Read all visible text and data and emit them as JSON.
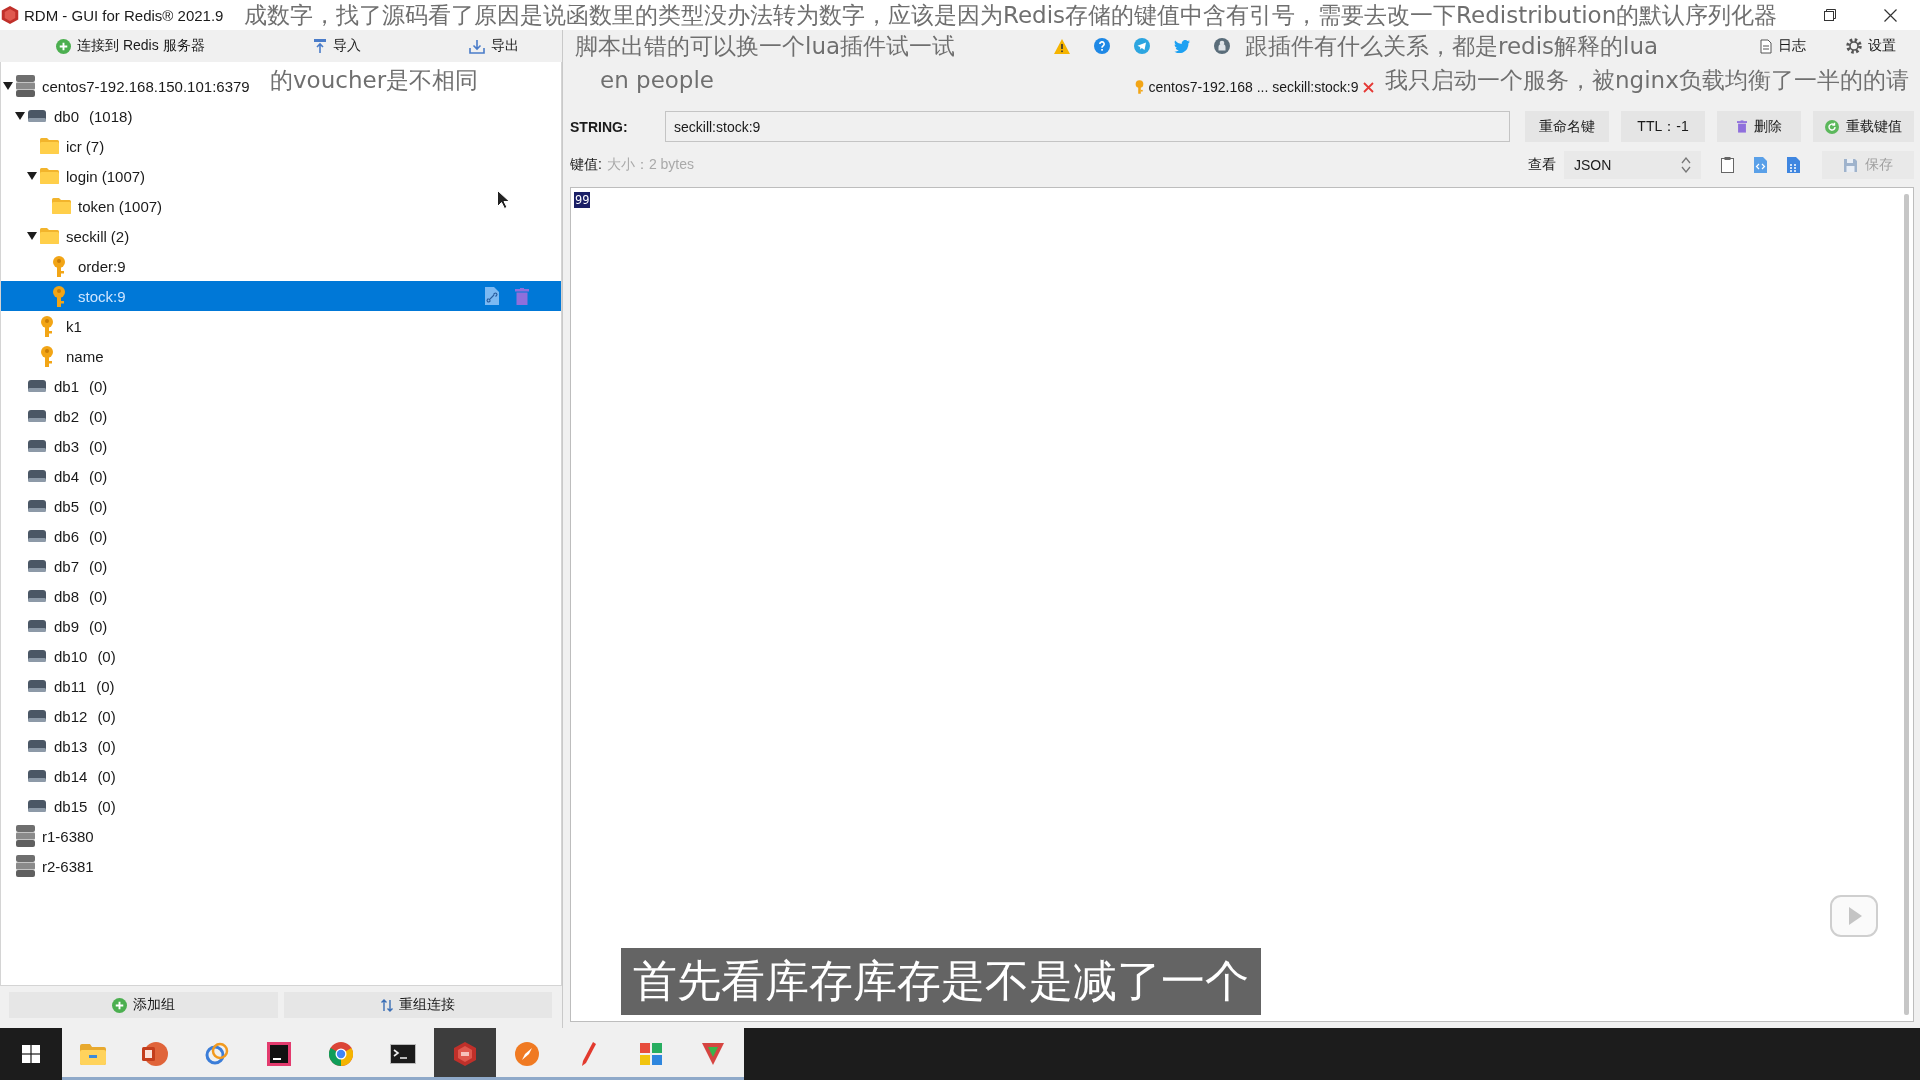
{
  "window": {
    "title": "RDM - GUI for Redis® 2021.9"
  },
  "toolbar": {
    "left": [
      {
        "kind": "connect",
        "label": "连接到 Redis 服务器"
      },
      {
        "kind": "import",
        "label": "导入"
      },
      {
        "kind": "export",
        "label": "导出"
      }
    ],
    "right": [
      {
        "kind": "log",
        "label": "日志"
      },
      {
        "kind": "settings",
        "label": "设置"
      }
    ]
  },
  "tree": [
    {
      "kind": "server",
      "label": "centos7-192.168.150.101:6379",
      "expanded": true,
      "selected": false,
      "children": [
        {
          "kind": "db",
          "label": "db0",
          "count": "(1018)",
          "expanded": true,
          "selected": false,
          "children": [
            {
              "kind": "folder",
              "label": "icr",
              "count": "(7)",
              "selected": false
            },
            {
              "kind": "folder",
              "label": "login",
              "count": "(1007)",
              "expanded": true,
              "selected": false,
              "children": [
                {
                  "kind": "folder",
                  "label": "token",
                  "count": "(1007)",
                  "selected": false
                }
              ]
            },
            {
              "kind": "folder",
              "label": "seckill",
              "count": "(2)",
              "expanded": true,
              "selected": false,
              "children": [
                {
                  "kind": "key",
                  "label": "order:9",
                  "selected": false
                },
                {
                  "kind": "key",
                  "label": "stock:9",
                  "selected": true
                }
              ]
            },
            {
              "kind": "key",
              "label": "k1",
              "selected": false
            },
            {
              "kind": "key",
              "label": "name",
              "selected": false
            }
          ]
        },
        {
          "kind": "db",
          "label": "db1",
          "count": "(0)",
          "selected": false
        },
        {
          "kind": "db",
          "label": "db2",
          "count": "(0)",
          "selected": false
        },
        {
          "kind": "db",
          "label": "db3",
          "count": "(0)",
          "selected": false
        },
        {
          "kind": "db",
          "label": "db4",
          "count": "(0)",
          "selected": false
        },
        {
          "kind": "db",
          "label": "db5",
          "count": "(0)",
          "selected": false
        },
        {
          "kind": "db",
          "label": "db6",
          "count": "(0)",
          "selected": false
        },
        {
          "kind": "db",
          "label": "db7",
          "count": "(0)",
          "selected": false
        },
        {
          "kind": "db",
          "label": "db8",
          "count": "(0)",
          "selected": false
        },
        {
          "kind": "db",
          "label": "db9",
          "count": "(0)",
          "selected": false
        },
        {
          "kind": "db",
          "label": "db10",
          "count": "(0)",
          "selected": false
        },
        {
          "kind": "db",
          "label": "db11",
          "count": "(0)",
          "selected": false
        },
        {
          "kind": "db",
          "label": "db12",
          "count": "(0)",
          "selected": false
        },
        {
          "kind": "db",
          "label": "db13",
          "count": "(0)",
          "selected": false
        },
        {
          "kind": "db",
          "label": "db14",
          "count": "(0)",
          "selected": false
        },
        {
          "kind": "db",
          "label": "db15",
          "count": "(0)",
          "selected": false
        }
      ]
    },
    {
      "kind": "server",
      "label": "r1-6380",
      "selected": false
    },
    {
      "kind": "server",
      "label": "r2-6381",
      "selected": false
    }
  ],
  "sidebar_buttons": [
    {
      "kind": "add",
      "label": "添加组"
    },
    {
      "kind": "regroup",
      "label": "重组连接"
    }
  ],
  "tabs": [
    {
      "label": "centos7-192.168 ... seckill:stock:9"
    }
  ],
  "key_view": {
    "type": "STRING:",
    "name": "seckill:stock:9",
    "actions": [
      {
        "kind": "rename",
        "label": "重命名键"
      },
      {
        "kind": "ttl",
        "label": "TTL：-1"
      },
      {
        "kind": "delete",
        "label": "删除"
      },
      {
        "kind": "reload",
        "label": "重载键值"
      }
    ],
    "value_label": "键值:",
    "size": "大小：2 bytes",
    "view_label": "查看",
    "view_mode": "JSON",
    "save": {
      "label": "保存",
      "disabled": true
    },
    "value": {
      "text": "99",
      "selected": true
    }
  },
  "taskbar": {
    "apps": [
      {
        "kind": "explorer",
        "running": true,
        "selected": false
      },
      {
        "kind": "presentation",
        "running": true,
        "selected": false
      },
      {
        "kind": "rings",
        "running": true,
        "selected": false
      },
      {
        "kind": "ide",
        "running": true,
        "selected": false
      },
      {
        "kind": "browser",
        "running": true,
        "selected": false
      },
      {
        "kind": "terminal",
        "running": true,
        "selected": false
      },
      {
        "kind": "redis-manager",
        "running": true,
        "selected": true
      },
      {
        "kind": "compass",
        "running": true,
        "selected": false
      },
      {
        "kind": "pen",
        "running": true,
        "selected": false
      },
      {
        "kind": "grid-app",
        "running": true,
        "selected": false
      },
      {
        "kind": "arrow-app",
        "running": true,
        "selected": false
      }
    ]
  },
  "overlay": {
    "comments": [
      "en people",
      "脚本出错的可以换一个lua插件试一试",
      "跟插件有什么关系，都是redis解释的lua",
      "的voucher是不相同",
      "我只启动一个服务，被nginx负载均衡了一半的的请",
      "成数字，找了源码看了原因是说函数里的类型没办法转为数字，应该是因为Redis存储的键值中含有引号，需要去改一下Redistribution的默认序列化器"
    ],
    "subtitle": "首先看库存库存是不是减了一个"
  }
}
